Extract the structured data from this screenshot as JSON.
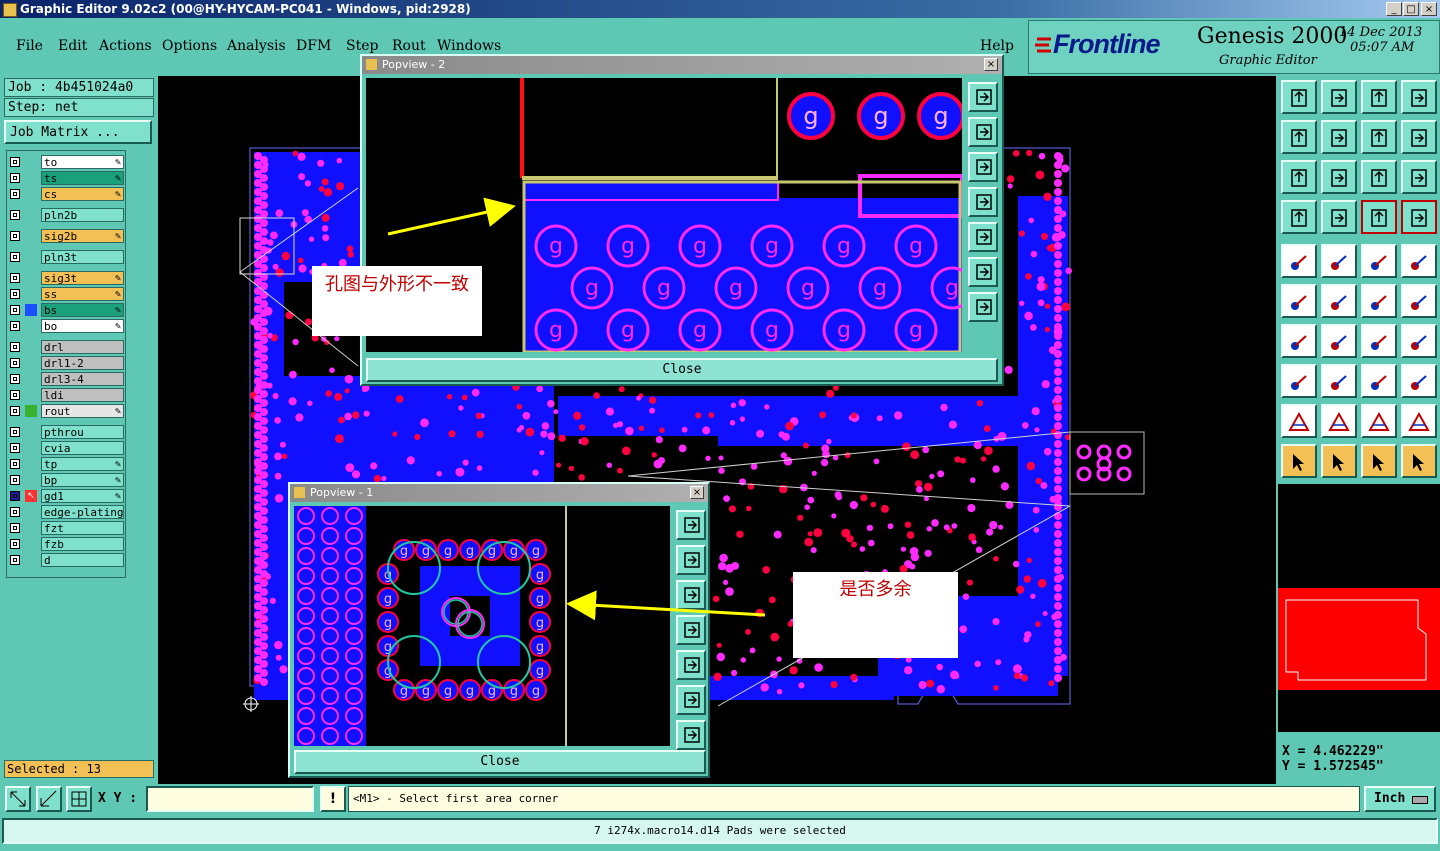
{
  "window": {
    "title": "Graphic Editor 9.02c2 (00@HY-HYCAM-PC041 - Windows, pid:2928)",
    "min": "_",
    "max": "□",
    "close": "×"
  },
  "menu": [
    "File",
    "Edit",
    "Actions",
    "Options",
    "Analysis",
    "DFM",
    "Step",
    "Rout",
    "Windows",
    "Help"
  ],
  "brand": {
    "logo": "Frontline",
    "product": "Genesis 2000",
    "subtitle": "Graphic Editor",
    "date": "14 Dec 2013",
    "time": "05:07 AM"
  },
  "job": {
    "job_label": "Job : 4b451024a0",
    "step_label": "Step: net",
    "matrix_button": "Job Matrix ..."
  },
  "layers": [
    {
      "name": "to",
      "color": "#ffffff",
      "edit": true
    },
    {
      "name": "ts",
      "color": "#1aa07a",
      "edit": true
    },
    {
      "name": "cs",
      "color": "#f3c056",
      "edit": true
    },
    {
      "name": "pln2b",
      "color": "#7fe0cc",
      "edit": false
    },
    {
      "name": "sig2b",
      "color": "#f3c056",
      "edit": true
    },
    {
      "name": "pln3t",
      "color": "#7fe0cc",
      "edit": false
    },
    {
      "name": "sig3t",
      "color": "#f3c056",
      "edit": true
    },
    {
      "name": "ss",
      "color": "#f3c056",
      "edit": true
    },
    {
      "name": "bs",
      "color": "#1aa07a",
      "edit": true
    },
    {
      "name": "bo",
      "color": "#ffffff",
      "edit": true
    },
    {
      "name": "drl",
      "color": "#bfbfbf",
      "edit": false
    },
    {
      "name": "drl1-2",
      "color": "#bfbfbf",
      "edit": false
    },
    {
      "name": "drl3-4",
      "color": "#bfbfbf",
      "edit": false
    },
    {
      "name": "ldi",
      "color": "#bfbfbf",
      "edit": false
    },
    {
      "name": "rout",
      "color": "#e6e6e6",
      "edit": true
    },
    {
      "name": "pthrou",
      "color": "#7fe0cc",
      "edit": false
    },
    {
      "name": "cvia",
      "color": "#7fe0cc",
      "edit": false
    },
    {
      "name": "tp",
      "color": "#7fe0cc",
      "edit": true
    },
    {
      "name": "bp",
      "color": "#7fe0cc",
      "edit": true
    },
    {
      "name": "gd1",
      "color": "#7fe0cc",
      "edit": true
    },
    {
      "name": "edge-plating",
      "color": "#7fe0cc",
      "edit": false
    },
    {
      "name": "fzt",
      "color": "#7fe0cc",
      "edit": false
    },
    {
      "name": "fzb",
      "color": "#7fe0cc",
      "edit": false
    },
    {
      "name": "d",
      "color": "#7fe0cc",
      "edit": false
    }
  ],
  "selected": "Selected : 13",
  "popup2": {
    "title": "Popview - 2",
    "close_label": "Close",
    "note": "孔图与外形不一致"
  },
  "popup1": {
    "title": "Popview - 1",
    "close_label": "Close",
    "note": "是否多余"
  },
  "pad_letter": "g",
  "coords": {
    "x": "X = 4.462229\"",
    "y": "Y = 1.572545\""
  },
  "bottom": {
    "xy_label": "X Y :",
    "xy_value": "",
    "bang": "!",
    "prompt": "<M1> - Select first area corner",
    "unit": "Inch",
    "status": "7 i274x.macro14.d14 Pads were selected"
  },
  "colors": {
    "pad": "#ff2aff",
    "copper": "#1010ff",
    "drill": "#ff0040",
    "highlight": "#22c8a0"
  }
}
